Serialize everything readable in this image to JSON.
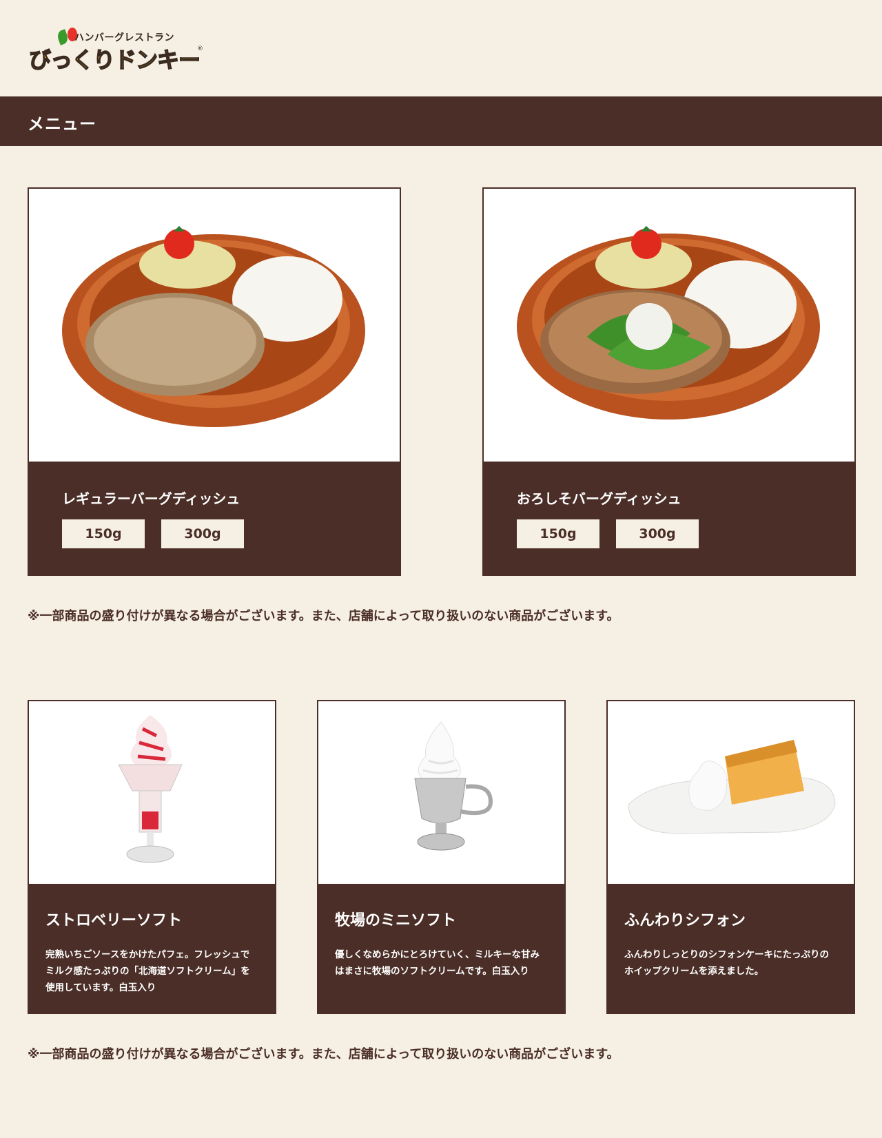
{
  "header": {
    "logo_sub": "ハンバーグレストラン",
    "logo_main": "びっくりドンキー",
    "logo_reg": "®"
  },
  "menu_bar": {
    "title": "メニュー"
  },
  "dishes": [
    {
      "name": "レギュラーバーグディッシュ",
      "sizes": [
        "150g",
        "300g"
      ]
    },
    {
      "name": "おろしそバーグディッシュ",
      "sizes": [
        "150g",
        "300g"
      ]
    }
  ],
  "note_1": "※一部商品の盛り付けが異なる場合がございます。また、店舗によって取り扱いのない商品がございます。",
  "desserts": [
    {
      "name": "ストロベリーソフト",
      "desc_lines": [
        "完熟いちごソースをかけたパフェ。フレッシュで",
        "ミルク感たっぷりの「北海道ソフトクリーム」を",
        "使用しています。白玉入り"
      ]
    },
    {
      "name": "牧場のミニソフト",
      "desc_lines": [
        "優しくなめらかにとろけていく、ミルキーな甘み",
        "はまさに牧場のソフトクリームです。白玉入り"
      ]
    },
    {
      "name": "ふんわりシフォン",
      "desc_lines": [
        "ふんわりしっとりのシフォンケーキにたっぷりの",
        "ホイップクリームを添えました。"
      ]
    }
  ],
  "note_2": "※一部商品の盛り付けが異なる場合がございます。また、店舗によって取り扱いのない商品がございます。",
  "colors": {
    "background": "#f6efe3",
    "brown": "#4a2e27",
    "logo_yellow": "#f5c400"
  }
}
